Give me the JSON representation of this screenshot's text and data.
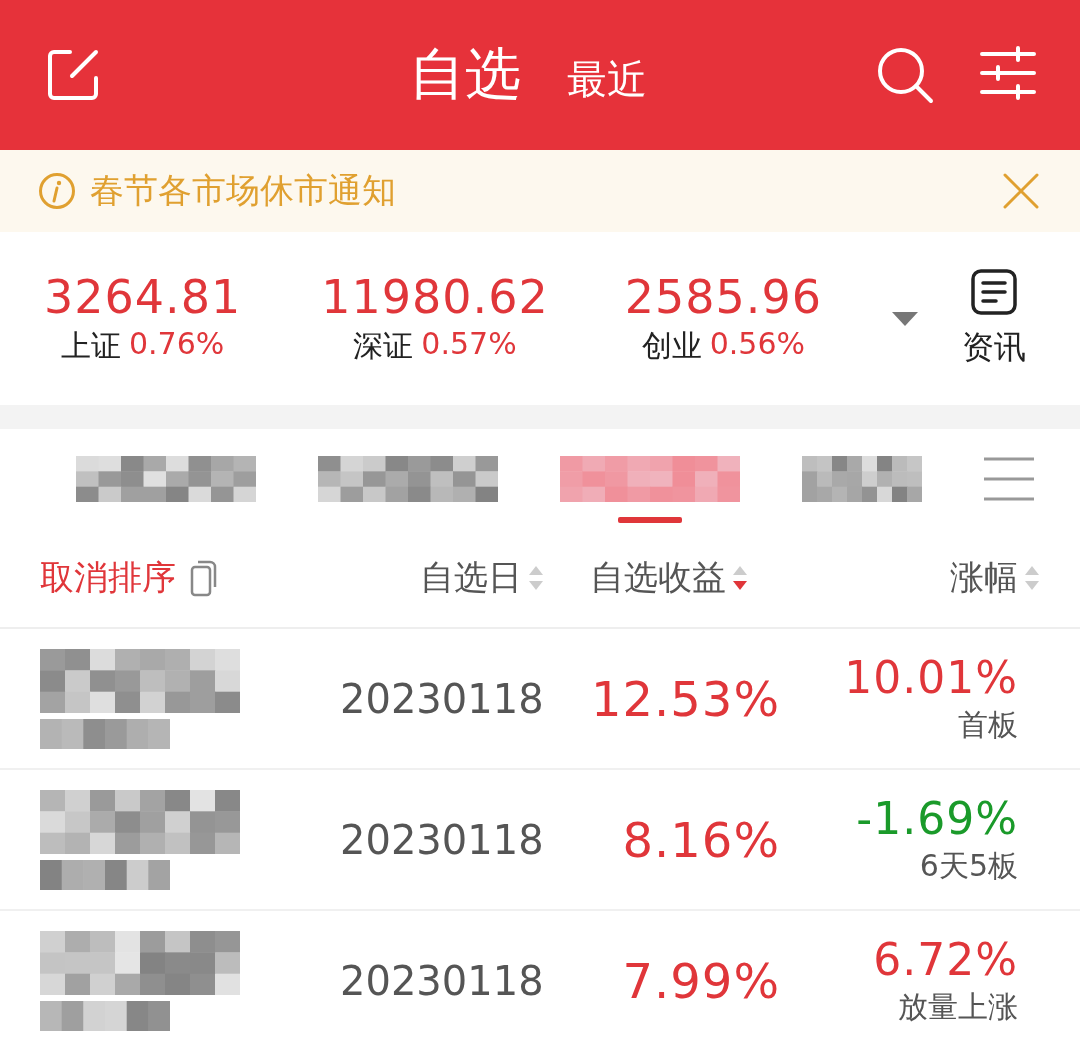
{
  "header": {
    "title": "自选",
    "subtitle": "最近"
  },
  "notice": {
    "text": "春节各市场休市通知"
  },
  "indices": [
    {
      "value": "3264.81",
      "name": "上证",
      "change": "0.76%"
    },
    {
      "value": "11980.62",
      "name": "深证",
      "change": "0.57%"
    },
    {
      "value": "2585.96",
      "name": "创业",
      "change": "0.56%"
    }
  ],
  "news": {
    "label": "资讯"
  },
  "tabs": [
    {
      "selected": false
    },
    {
      "selected": false
    },
    {
      "selected": true
    },
    {
      "selected": false
    }
  ],
  "table": {
    "sort_reset": "取消排序",
    "columns": [
      {
        "label": "自选日",
        "sorted": false
      },
      {
        "label": "自选收益",
        "sorted": true
      },
      {
        "label": "涨幅",
        "sorted": false
      }
    ],
    "rows": [
      {
        "date": "20230118",
        "gain": "12.53%",
        "change": "10.01%",
        "color": "#e0363a",
        "tag": "首板"
      },
      {
        "date": "20230118",
        "gain": "8.16%",
        "change": "-1.69%",
        "color": "#1a9a2a",
        "tag": "6天5板"
      },
      {
        "date": "20230118",
        "gain": "7.99%",
        "change": "6.72%",
        "color": "#e0363a",
        "tag": "放量上涨"
      }
    ]
  }
}
